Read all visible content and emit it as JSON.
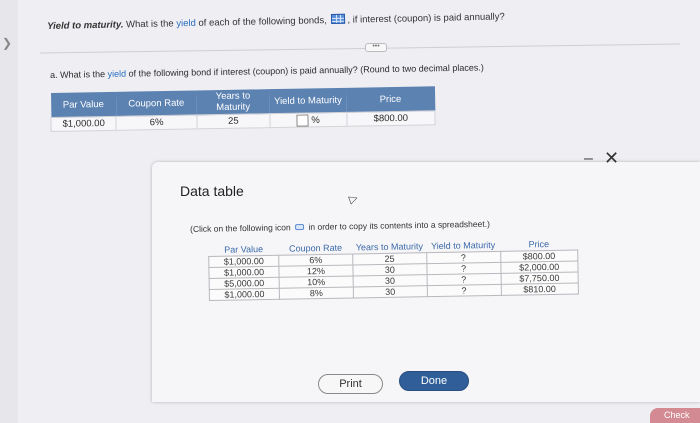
{
  "question": {
    "title": "Yield to maturity.",
    "text_before_link": " What is the ",
    "link": "yield",
    "text_after_link": " of each of the following bonds,",
    "text_after_icon": ", if interest (coupon) is paid annually?"
  },
  "part_a": {
    "prefix": "a. What is the ",
    "link": "yield",
    "suffix": " of the following bond if interest (coupon) is paid annually?  (Round to two decimal places.)",
    "headers": [
      "Par Value",
      "Coupon Rate",
      "Years to Maturity",
      "Yield to Maturity",
      "Price"
    ],
    "row": {
      "par_value": "$1,000.00",
      "coupon_rate": "6%",
      "years": "25",
      "percent_sign": "%",
      "price": "$800.00"
    }
  },
  "modal": {
    "title": "Data table",
    "minimize": "–",
    "close": "✕",
    "copy_before": "(Click on the following icon",
    "copy_after": " in order to copy its contents into a spreadsheet.)",
    "headers": [
      "Par Value",
      "Coupon Rate",
      "Years to Maturity",
      "Yield to Maturity",
      "Price"
    ],
    "rows": [
      [
        "$1,000.00",
        "6%",
        "25",
        "?",
        "$800.00"
      ],
      [
        "$1,000.00",
        "12%",
        "30",
        "?",
        "$2,000.00"
      ],
      [
        "$5,000.00",
        "10%",
        "30",
        "?",
        "$7,750.00"
      ],
      [
        "$1,000.00",
        "8%",
        "30",
        "?",
        "$810.00"
      ]
    ],
    "print_label": "Print",
    "done_label": "Done"
  },
  "check_label": "Check",
  "colors": {
    "header_blue": "#5c82b2",
    "done_blue": "#2f5e98",
    "link_blue": "#2a6fc0",
    "check_pink": "#d38a93"
  }
}
